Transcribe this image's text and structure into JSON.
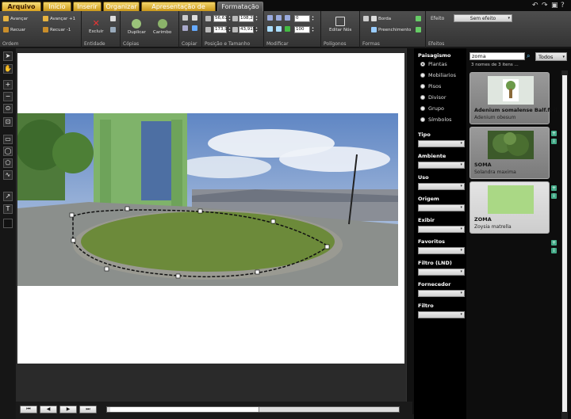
{
  "tabs": [
    {
      "label": "Arquivo"
    },
    {
      "label": "Início"
    },
    {
      "label": "Inserir"
    },
    {
      "label": "Organizar"
    },
    {
      "label": "Apresentação de Slides"
    },
    {
      "label": "Formatação"
    }
  ],
  "ribbon": {
    "ordem": {
      "title": "Ordem",
      "avancar": "Avançar",
      "recuar": "Recuar",
      "avancar1": "Avançar +1",
      "recuar1": "Recuar -1"
    },
    "entidade": {
      "title": "Entidade",
      "excluir": "Excluir"
    },
    "copias": {
      "title": "Cópias",
      "duplicar": "Duplicar",
      "carimbo": "Carimbo"
    },
    "copiar": {
      "title": "Copiar"
    },
    "posicao": {
      "title": "Posição e Tamanho",
      "x": "56,61",
      "y": "173,9",
      "w": "108,2",
      "h": "43,915"
    },
    "modificar": {
      "title": "Modificar",
      "v1": "0",
      "v2": "100"
    },
    "poligonos": {
      "title": "Polígonos",
      "editar": "Editar Nós"
    },
    "formas": {
      "title": "Formas",
      "borda": "Borda",
      "preenchimento": "Preenchimento"
    },
    "efeitos": {
      "title": "Efeitos",
      "label": "Efeito",
      "value": "Sem efeito"
    }
  },
  "filters": {
    "paisagismo": "Paisagismo",
    "options": [
      "Plantas",
      "Mobiliarios",
      "Pisos",
      "Divisor",
      "Grupo",
      "Símbolos"
    ],
    "selected": "Plantas",
    "headers": [
      "Tipo",
      "Ambiente",
      "Uso",
      "Origem",
      "Exibir",
      "Favoritos",
      "Filtro (LND)",
      "Fornecedor",
      "Filtro"
    ]
  },
  "library": {
    "search": "zoma",
    "scope": "Todos",
    "results": "3 nomes de 3 itens ...",
    "items": [
      {
        "name": "Adenium somalense Balf.f. (i",
        "sci": "Adenium obesum"
      },
      {
        "name": "SOMA",
        "sci": "Solandra maxima"
      },
      {
        "name": "ZOMA",
        "sci": "Zoysia matrella"
      }
    ]
  },
  "colors": {
    "tab_gold": "#d9a21f",
    "ribbon": "#3e3e3e",
    "grass": "#6c8a3a",
    "chapel_green": "#7fb36a",
    "sky": "#8fb0d9"
  }
}
